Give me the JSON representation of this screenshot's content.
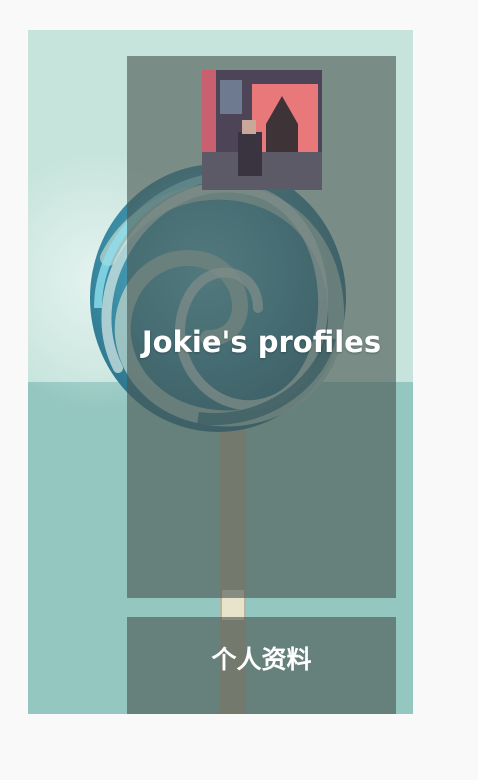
{
  "profile": {
    "title": "Jokie's profiles",
    "avatar_icon": "avatar-photo-icon"
  },
  "menu": {
    "personal_info_label": "个人资料"
  },
  "colors": {
    "frame_light": "#c6e4dc",
    "frame_dark": "#94c7c0",
    "overlay": "#4b5550",
    "text": "#ffffff"
  }
}
